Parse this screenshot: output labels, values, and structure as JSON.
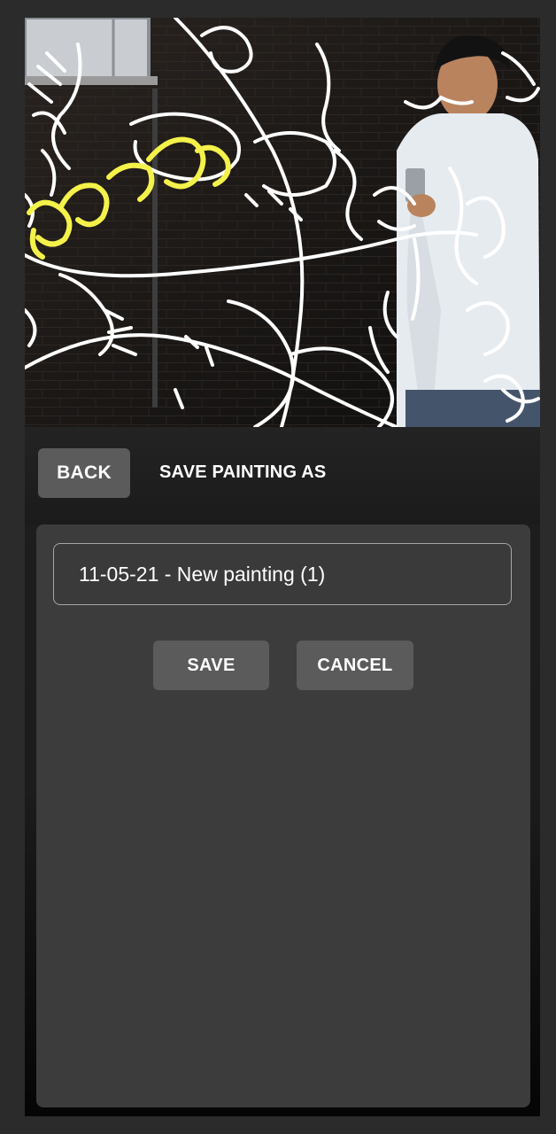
{
  "header": {
    "back_label": "BACK",
    "title": "SAVE PAINTING AS"
  },
  "dialog": {
    "name_value": "11-05-21 - New painting (1)",
    "save_label": "SAVE",
    "cancel_label": "CANCEL"
  },
  "preview": {
    "ink_color": "#ffffff",
    "highlight_ink_color": "#f4f24a"
  }
}
